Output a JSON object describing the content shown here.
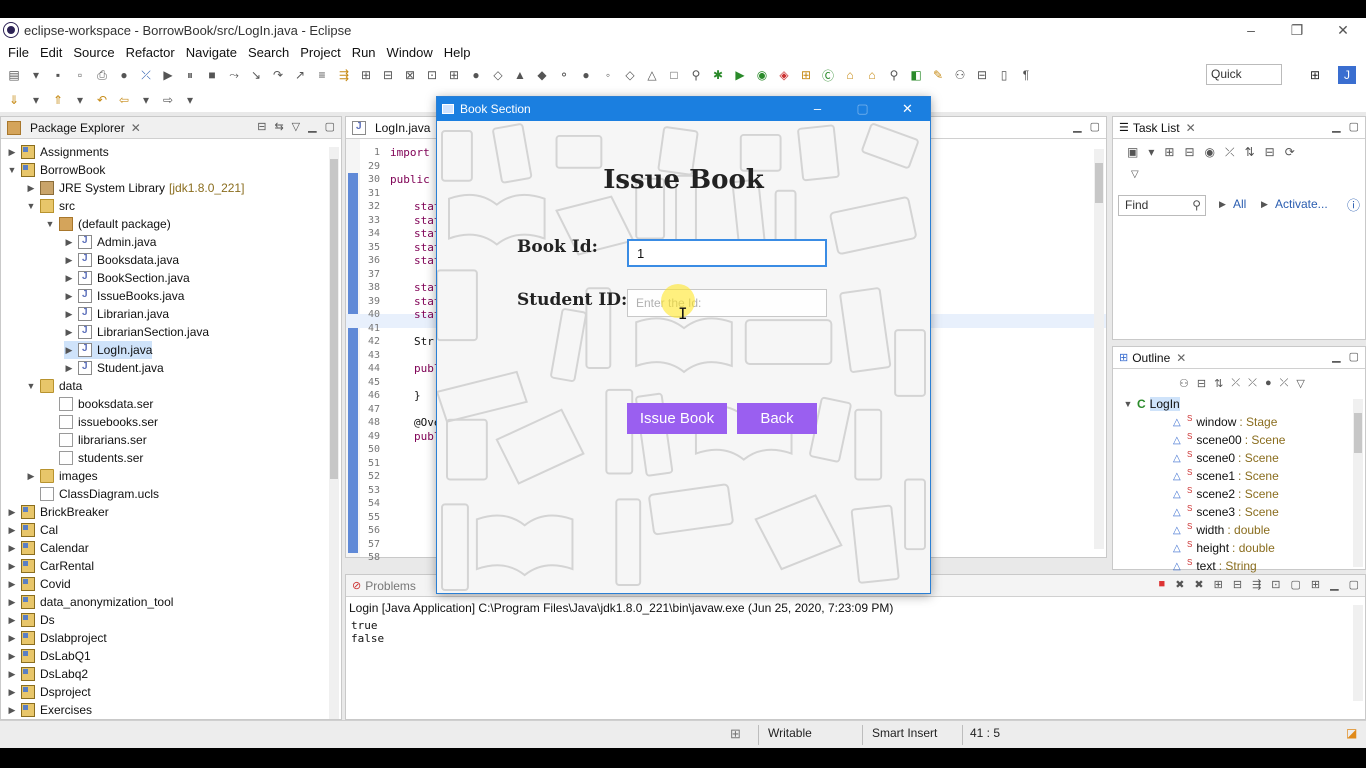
{
  "window": {
    "title": "eclipse-workspace - BorrowBook/src/LogIn.java - Eclipse",
    "controls": [
      "–",
      "❐",
      "✕"
    ]
  },
  "menu": [
    "File",
    "Edit",
    "Source",
    "Refactor",
    "Navigate",
    "Search",
    "Project",
    "Run",
    "Window",
    "Help"
  ],
  "quick_access": "Quick Access",
  "package_explorer": {
    "title": "Package Explorer",
    "rows": [
      {
        "label": "Assignments",
        "icon": "project-icon"
      },
      {
        "label": "BorrowBook",
        "icon": "project-icon"
      },
      {
        "label": "JRE System Library",
        "extra": "[jdk1.8.0_221]",
        "icon": "library-icon"
      },
      {
        "label": "src",
        "icon": "source-folder-icon"
      },
      {
        "label": "(default package)",
        "icon": "package-icon"
      },
      {
        "label": "Admin.java",
        "icon": "java-file-icon"
      },
      {
        "label": "Booksdata.java",
        "icon": "java-file-icon"
      },
      {
        "label": "BookSection.java",
        "icon": "java-file-icon"
      },
      {
        "label": "IssueBooks.java",
        "icon": "java-file-icon"
      },
      {
        "label": "Librarian.java",
        "icon": "java-file-icon"
      },
      {
        "label": "LibrarianSection.java",
        "icon": "java-file-icon"
      },
      {
        "label": "LogIn.java",
        "icon": "java-file-icon"
      },
      {
        "label": "Student.java",
        "icon": "java-file-icon"
      },
      {
        "label": "data",
        "icon": "folder-icon"
      },
      {
        "label": "booksdata.ser",
        "icon": "file-icon"
      },
      {
        "label": "issuebooks.ser",
        "icon": "file-icon"
      },
      {
        "label": "librarians.ser",
        "icon": "file-icon"
      },
      {
        "label": "students.ser",
        "icon": "file-icon"
      },
      {
        "label": "images",
        "icon": "folder-icon"
      },
      {
        "label": "ClassDiagram.ucls",
        "icon": "file-icon"
      },
      {
        "label": "BrickBreaker",
        "icon": "project-icon"
      },
      {
        "label": "Cal",
        "icon": "project-icon"
      },
      {
        "label": "Calendar",
        "icon": "project-icon"
      },
      {
        "label": "CarRental",
        "icon": "project-icon"
      },
      {
        "label": "Covid",
        "icon": "project-icon"
      },
      {
        "label": "data_anonymization_tool",
        "icon": "project-icon"
      },
      {
        "label": "Ds",
        "icon": "project-icon"
      },
      {
        "label": "Dslabproject",
        "icon": "project-icon"
      },
      {
        "label": "DsLabQ1",
        "icon": "project-icon"
      },
      {
        "label": "DsLabq2",
        "icon": "project-icon"
      },
      {
        "label": "Dsproject",
        "icon": "project-icon"
      },
      {
        "label": "Exercises",
        "icon": "project-icon"
      }
    ]
  },
  "editor": {
    "tab": "LogIn.java",
    "lines": [
      {
        "no": "1",
        "code": "import"
      },
      {
        "no": "29",
        "code": ""
      },
      {
        "no": "30",
        "code": "public c"
      },
      {
        "no": "31",
        "code": ""
      },
      {
        "no": "32",
        "code": "stat"
      },
      {
        "no": "33",
        "code": "stat"
      },
      {
        "no": "34",
        "code": "stat"
      },
      {
        "no": "35",
        "code": "stat"
      },
      {
        "no": "36",
        "code": "stat"
      },
      {
        "no": "37",
        "code": ""
      },
      {
        "no": "38",
        "code": "stat"
      },
      {
        "no": "39",
        "code": "stat"
      },
      {
        "no": "40",
        "code": "stat"
      },
      {
        "no": "41",
        "code": ""
      },
      {
        "no": "42",
        "code": "Str"
      },
      {
        "no": "43",
        "code": ""
      },
      {
        "no": "44",
        "code": "publ"
      },
      {
        "no": "45",
        "code": ""
      },
      {
        "no": "46",
        "code": "}"
      },
      {
        "no": "47",
        "code": ""
      },
      {
        "no": "48",
        "code": "@Ove"
      },
      {
        "no": "49",
        "code": "publ"
      },
      {
        "no": "50",
        "code": ""
      },
      {
        "no": "51",
        "code": ""
      },
      {
        "no": "52",
        "code": ""
      },
      {
        "no": "53",
        "code": ""
      },
      {
        "no": "54",
        "code": ""
      },
      {
        "no": "55",
        "code": ""
      },
      {
        "no": "56",
        "code": ""
      },
      {
        "no": "57",
        "code": ""
      },
      {
        "no": "58",
        "code": ""
      }
    ]
  },
  "task_list": {
    "title": "Task List",
    "find_placeholder": "Find",
    "all_label": "All",
    "activate_label": "Activate..."
  },
  "outline": {
    "title": "Outline",
    "root": "LogIn",
    "items": [
      {
        "name": "window",
        "type": ": Stage"
      },
      {
        "name": "scene00",
        "type": ": Scene"
      },
      {
        "name": "scene0",
        "type": ": Scene"
      },
      {
        "name": "scene1",
        "type": ": Scene"
      },
      {
        "name": "scene2",
        "type": ": Scene"
      },
      {
        "name": "scene3",
        "type": ": Scene"
      },
      {
        "name": "width",
        "type": ": double"
      },
      {
        "name": "height",
        "type": ": double"
      },
      {
        "name": "text",
        "type": ": String"
      }
    ]
  },
  "console": {
    "tab": "Problems",
    "header": "Login [Java Application] C:\\Program Files\\Java\\jdk1.8.0_221\\bin\\javaw.exe (Jun 25, 2020, 7:23:09 PM)",
    "lines": [
      "true",
      "false"
    ]
  },
  "status": {
    "writable": "Writable",
    "insert_mode": "Smart Insert",
    "position": "41 : 5"
  },
  "dialog": {
    "title": "Book Section",
    "heading": "Issue Book",
    "book_id_label": "Book Id:",
    "book_id_value": "1",
    "student_id_label": "Student ID:",
    "student_id_placeholder": "Enter the Id:",
    "issue_button": "Issue Book",
    "back_button": "Back",
    "accent_color": "#9a5ff0",
    "titlebar_color": "#1b7fe0"
  }
}
